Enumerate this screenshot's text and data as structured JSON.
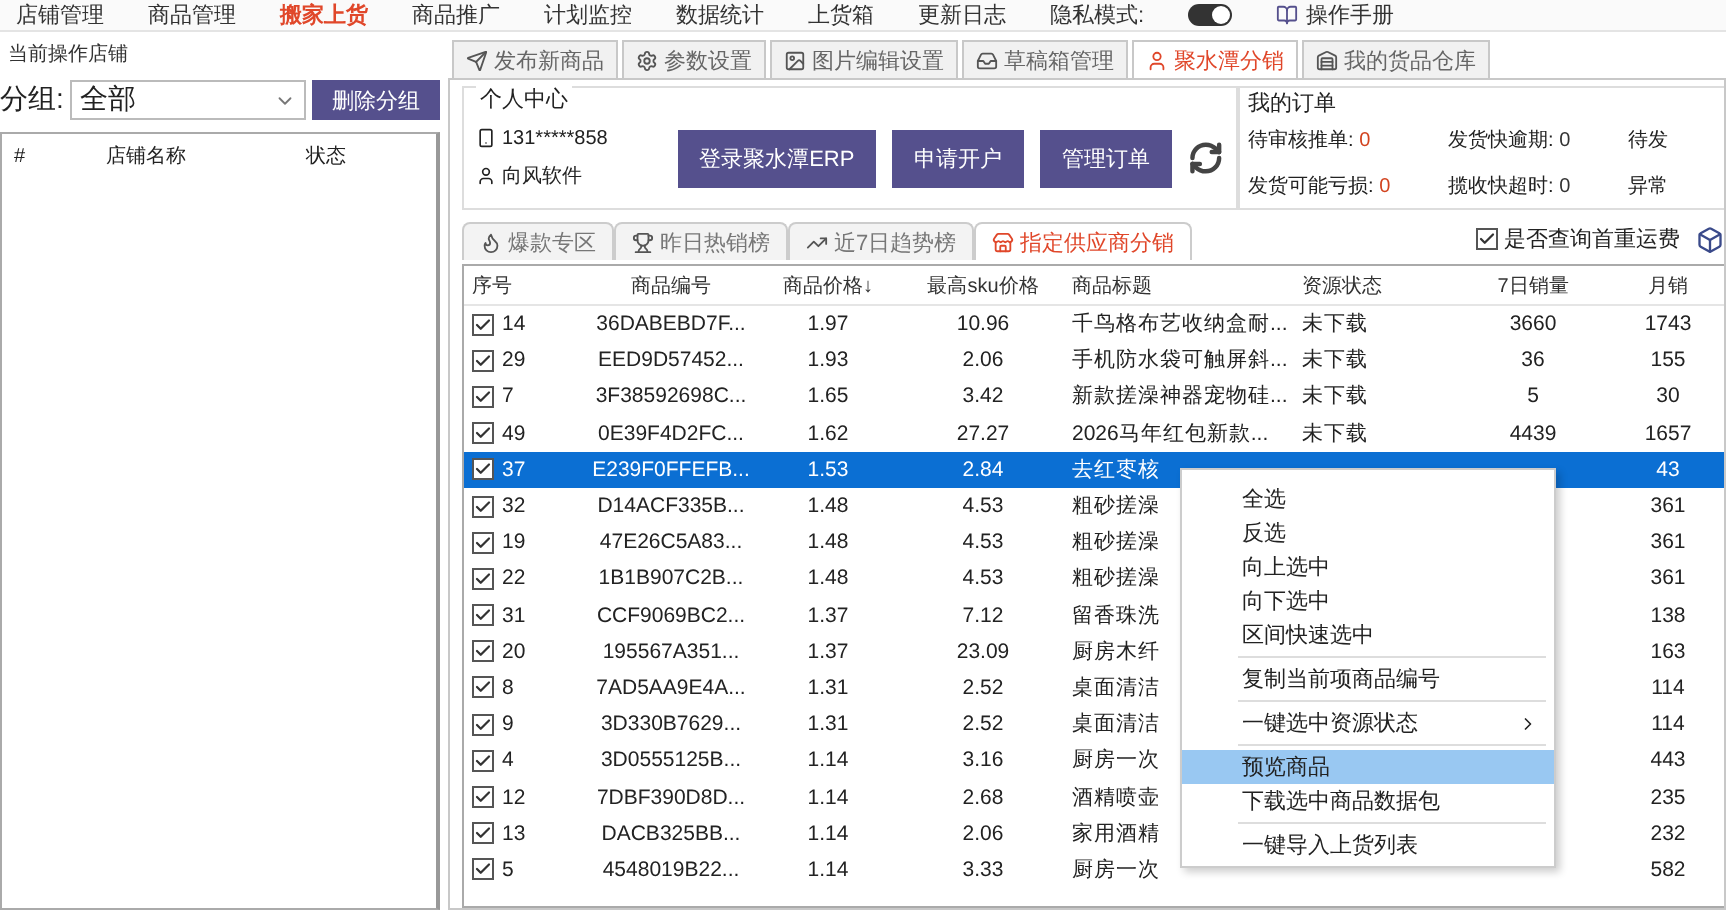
{
  "top_menu": [
    {
      "label": "店铺管理",
      "selected": false
    },
    {
      "label": "商品管理",
      "selected": false
    },
    {
      "label": "搬家上货",
      "selected": true
    },
    {
      "label": "商品推广",
      "selected": false
    },
    {
      "label": "计划监控",
      "selected": false
    },
    {
      "label": "数据统计",
      "selected": false
    },
    {
      "label": "上货箱",
      "selected": false
    },
    {
      "label": "更新日志",
      "selected": false
    }
  ],
  "privacy_mode": {
    "label": "隐私模式:",
    "on": true
  },
  "manual": "操作手册",
  "sidebar": {
    "title": "当前操作店铺",
    "group_label": "分组:",
    "group_value": "全部",
    "delete_button": "删除分组",
    "columns": [
      "#",
      "店铺名称",
      "状态"
    ]
  },
  "tabs": [
    {
      "label": "发布新商品",
      "selected": false
    },
    {
      "label": "参数设置",
      "selected": false
    },
    {
      "label": "图片编辑设置",
      "selected": false
    },
    {
      "label": "草稿箱管理",
      "selected": false
    },
    {
      "label": "聚水潭分销",
      "selected": true
    },
    {
      "label": "我的货品仓库",
      "selected": false
    }
  ],
  "personal_center": {
    "title": "个人中心",
    "phone": "131*****858",
    "user": "向风软件",
    "buttons": [
      "登录聚水潭ERP",
      "申请开户",
      "管理订单"
    ]
  },
  "orders": {
    "title": "我的订单",
    "items": [
      {
        "label": "待审核推单:",
        "value": "0",
        "alert": true
      },
      {
        "label": "发货快逾期:",
        "value": "0",
        "alert": false
      },
      {
        "label": "待发"
      },
      {
        "label": "发货可能亏损:",
        "value": "0",
        "alert": true
      },
      {
        "label": "揽收快超时:",
        "value": "0",
        "alert": false
      },
      {
        "label": "异常"
      }
    ]
  },
  "sub_tabs": [
    {
      "label": "爆款专区",
      "selected": false
    },
    {
      "label": "昨日热销榜",
      "selected": false
    },
    {
      "label": "近7日趋势榜",
      "selected": false
    },
    {
      "label": "指定供应商分销",
      "selected": true
    }
  ],
  "freight_option": {
    "label": "是否查询首重运费",
    "checked": true
  },
  "table": {
    "columns": [
      "序号",
      "商品编号",
      "商品价格↓",
      "最高sku价格",
      "商品标题",
      "资源状态",
      "7日销量",
      "月销"
    ],
    "rows": [
      {
        "checked": true,
        "selected": false,
        "cells": [
          "14",
          "36DABEBD7F...",
          "1.97",
          "10.96",
          "千鸟格布艺收纳盒耐...",
          "未下载",
          "3660",
          "1743"
        ]
      },
      {
        "checked": true,
        "selected": false,
        "cells": [
          "29",
          "EED9D57452...",
          "1.93",
          "2.06",
          "手机防水袋可触屏斜...",
          "未下载",
          "36",
          "155"
        ]
      },
      {
        "checked": true,
        "selected": false,
        "cells": [
          "7",
          "3F38592698C...",
          "1.65",
          "3.42",
          "新款搓澡神器宠物硅...",
          "未下载",
          "5",
          "30"
        ]
      },
      {
        "checked": true,
        "selected": false,
        "cells": [
          "49",
          "0E39F4D2FC...",
          "1.62",
          "27.27",
          "2026马年红包新款...",
          "未下载",
          "4439",
          "1657"
        ]
      },
      {
        "checked": true,
        "selected": true,
        "cells": [
          "37",
          "E239F0FFEFB...",
          "1.53",
          "2.84",
          "去红枣核",
          "",
          "",
          "43"
        ]
      },
      {
        "checked": true,
        "selected": false,
        "cells": [
          "32",
          "D14ACF335B...",
          "1.48",
          "4.53",
          "粗砂搓澡",
          "",
          "",
          "361"
        ]
      },
      {
        "checked": true,
        "selected": false,
        "cells": [
          "19",
          "47E26C5A83...",
          "1.48",
          "4.53",
          "粗砂搓澡",
          "",
          "",
          "361"
        ]
      },
      {
        "checked": true,
        "selected": false,
        "cells": [
          "22",
          "1B1B907C2B...",
          "1.48",
          "4.53",
          "粗砂搓澡",
          "",
          "",
          "361"
        ]
      },
      {
        "checked": true,
        "selected": false,
        "cells": [
          "31",
          "CCF9069BC2...",
          "1.37",
          "7.12",
          "留香珠洗",
          "",
          "",
          "138"
        ]
      },
      {
        "checked": true,
        "selected": false,
        "cells": [
          "20",
          "195567A351...",
          "1.37",
          "23.09",
          "厨房木纤",
          "",
          "",
          "163"
        ]
      },
      {
        "checked": true,
        "selected": false,
        "cells": [
          "8",
          "7AD5AA9E4A...",
          "1.31",
          "2.52",
          "桌面清洁",
          "",
          "",
          "114"
        ]
      },
      {
        "checked": true,
        "selected": false,
        "cells": [
          "9",
          "3D330B7629...",
          "1.31",
          "2.52",
          "桌面清洁",
          "",
          "",
          "114"
        ]
      },
      {
        "checked": true,
        "selected": false,
        "cells": [
          "4",
          "3D0555125B...",
          "1.14",
          "3.16",
          "厨房一次",
          "",
          "",
          "443"
        ]
      },
      {
        "checked": true,
        "selected": false,
        "cells": [
          "12",
          "7DBF390D8D...",
          "1.14",
          "2.68",
          "酒精喷壶",
          "",
          "",
          "235"
        ]
      },
      {
        "checked": true,
        "selected": false,
        "cells": [
          "13",
          "DACB325BB...",
          "1.14",
          "2.06",
          "家用酒精",
          "",
          "",
          "232"
        ]
      },
      {
        "checked": true,
        "selected": false,
        "cells": [
          "5",
          "4548019B22...",
          "1.14",
          "3.33",
          "厨房一次",
          "",
          "",
          "582"
        ]
      }
    ]
  },
  "context_menu": [
    {
      "kind": "item",
      "label": "全选",
      "selected": false
    },
    {
      "kind": "item",
      "label": "反选",
      "selected": false
    },
    {
      "kind": "item",
      "label": "向上选中",
      "selected": false
    },
    {
      "kind": "item",
      "label": "向下选中",
      "selected": false
    },
    {
      "kind": "item",
      "label": "区间快速选中",
      "selected": false
    },
    {
      "kind": "separator"
    },
    {
      "kind": "item",
      "label": "复制当前项商品编号",
      "selected": false
    },
    {
      "kind": "separator"
    },
    {
      "kind": "submenu",
      "label": "一键选中资源状态",
      "selected": false
    },
    {
      "kind": "separator"
    },
    {
      "kind": "item",
      "label": "预览商品",
      "selected": true
    },
    {
      "kind": "item",
      "label": "下载选中商品数据包",
      "selected": false
    },
    {
      "kind": "separator"
    },
    {
      "kind": "item",
      "label": "一键导入上货列表",
      "selected": false
    }
  ]
}
